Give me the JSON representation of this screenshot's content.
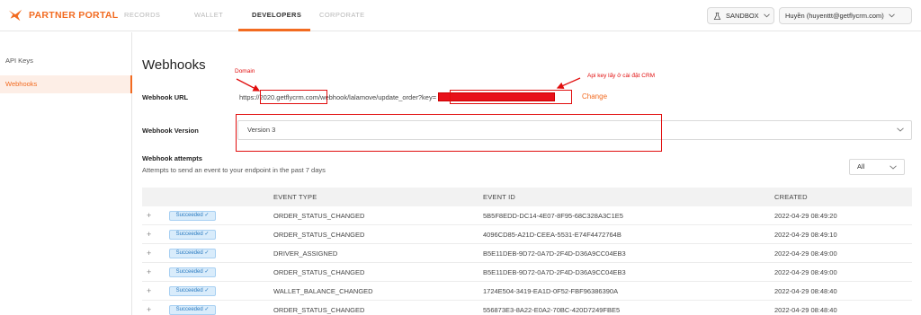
{
  "header": {
    "brand": "PARTNER PORTAL",
    "nav": [
      {
        "label": "RECORDS",
        "active": false
      },
      {
        "label": "WALLET",
        "active": false
      },
      {
        "label": "DEVELOPERS",
        "active": true
      },
      {
        "label": "CORPORATE",
        "active": false
      }
    ],
    "env_label": "SANDBOX",
    "user_label": "Huyền (huyenttt@getflycrm.com)"
  },
  "sidebar": {
    "items": [
      {
        "label": "API Keys",
        "active": false
      },
      {
        "label": "Webhooks",
        "active": true
      }
    ]
  },
  "main": {
    "title": "Webhooks",
    "url_label": "Webhook URL",
    "url_prefix": "https://",
    "url_domain": "2020.getflycrm.com",
    "url_path": "/webhook/lalamove/update_order?key=",
    "change_label": "Change",
    "version_label": "Webhook Version",
    "version_value": "Version 3",
    "attempts_title": "Webhook attempts",
    "attempts_subtitle": "Attempts to send an event to your endpoint in the past 7 days",
    "filter_value": "All",
    "columns": [
      "EVENT TYPE",
      "EVENT ID",
      "CREATED"
    ],
    "rows": [
      {
        "status": "Succeeded ✓",
        "event_type": "ORDER_STATUS_CHANGED",
        "event_id": "5B5F8EDD-DC14-4E07-8F95-68C328A3C1E5",
        "created": "2022-04-29 08:49:20"
      },
      {
        "status": "Succeeded ✓",
        "event_type": "ORDER_STATUS_CHANGED",
        "event_id": "4096CD85-A21D-CEEA-5531-E74F4472764B",
        "created": "2022-04-29 08:49:10"
      },
      {
        "status": "Succeeded ✓",
        "event_type": "DRIVER_ASSIGNED",
        "event_id": "B5E11DEB-9D72-0A7D-2F4D-D36A9CC04EB3",
        "created": "2022-04-29 08:49:00"
      },
      {
        "status": "Succeeded ✓",
        "event_type": "ORDER_STATUS_CHANGED",
        "event_id": "B5E11DEB-9D72-0A7D-2F4D-D36A9CC04EB3",
        "created": "2022-04-29 08:49:00"
      },
      {
        "status": "Succeeded ✓",
        "event_type": "WALLET_BALANCE_CHANGED",
        "event_id": "1724E504-3419-EA1D-0F52-FBF96386390A",
        "created": "2022-04-29 08:48:40"
      },
      {
        "status": "Succeeded ✓",
        "event_type": "ORDER_STATUS_CHANGED",
        "event_id": "556873E3-8A22-E0A2-70BC-420D7249FBE5",
        "created": "2022-04-29 08:48:40"
      }
    ]
  },
  "annotations": {
    "domain_note": "Domain",
    "apikey_note": "Api key lấy ở cài đặt CRM"
  },
  "colors": {
    "accent": "#f26b21",
    "annotation": "#e10e0e",
    "badge_bg": "#d9ecfb"
  }
}
